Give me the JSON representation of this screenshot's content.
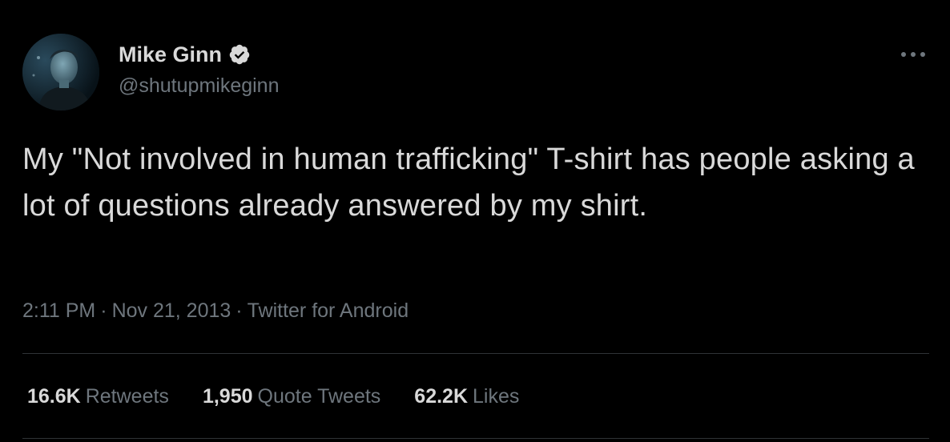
{
  "author": {
    "display_name": "Mike Ginn",
    "handle": "@shutupmikeginn",
    "verified": true
  },
  "tweet": {
    "text": "My \"Not involved in human trafficking\" T-shirt has people asking a lot of questions already answered by my shirt.",
    "time": "2:11 PM",
    "separator": "·",
    "date": "Nov 21, 2013",
    "source": "Twitter for Android"
  },
  "stats": {
    "retweets": {
      "count": "16.6K",
      "label": "Retweets"
    },
    "quote_tweets": {
      "count": "1,950",
      "label": "Quote Tweets"
    },
    "likes": {
      "count": "62.2K",
      "label": "Likes"
    }
  },
  "icons": {
    "verified": "verified-badge-icon",
    "more": "more-horizontal-icon"
  },
  "colors": {
    "background": "#000000",
    "primary_text": "#d9d9d9",
    "secondary_text": "#6e767d",
    "divider": "#2f3336"
  }
}
